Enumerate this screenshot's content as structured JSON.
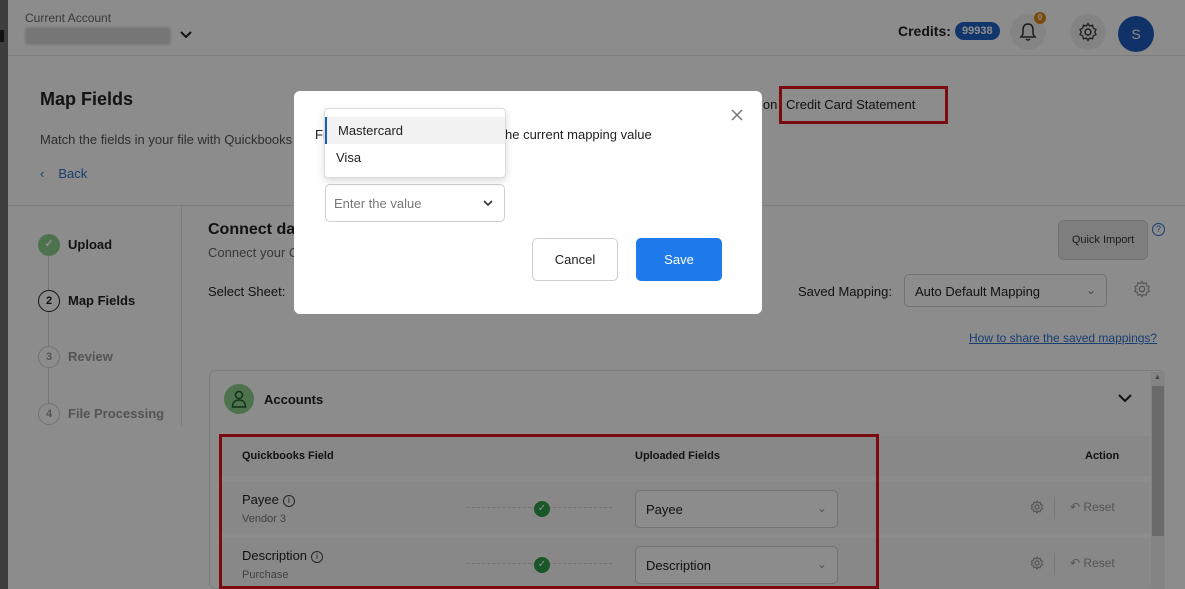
{
  "header": {
    "account_label": "Current Account",
    "credits_label": "Credits:",
    "credits_value": "99938",
    "notification_count": "0",
    "avatar_initial": "S"
  },
  "page": {
    "title": "Map Fields",
    "subtitle": "Match the fields in your file with Quickbooks f",
    "back_label": "Back",
    "statement_prefix": "ion",
    "statement_type": "Credit Card Statement"
  },
  "stepper": [
    {
      "number": "",
      "label": "Upload",
      "state": "done"
    },
    {
      "number": "2",
      "label": "Map Fields",
      "state": "active"
    },
    {
      "number": "3",
      "label": "Review",
      "state": "pending"
    },
    {
      "number": "4",
      "label": "File Processing",
      "state": "pending"
    }
  ],
  "content": {
    "connect_title": "Connect da",
    "connect_sub": "Connect your C",
    "select_sheet_label": "Select Sheet:",
    "quick_import_label": "Quick Import",
    "help_glyph": "?",
    "saved_mapping_label": "Saved Mapping:",
    "saved_mapping_value": "Auto Default Mapping",
    "share_link": "How to share the saved mappings?"
  },
  "accounts_section": {
    "title": "Accounts",
    "columns": {
      "field": "Quickbooks Field",
      "uploaded": "Uploaded Fields",
      "action": "Action"
    },
    "rows": [
      {
        "field": "Payee",
        "sub": "Vendor 3",
        "uploaded": "Payee",
        "reset": "Reset"
      },
      {
        "field": "Description",
        "sub": "Purchase",
        "uploaded": "Description",
        "reset": "Reset"
      }
    ]
  },
  "modal": {
    "text_left": "Fi",
    "text_right": "he current mapping value",
    "select_placeholder": "Enter the value",
    "options": [
      "Mastercard",
      "Visa"
    ],
    "active_option": "Mastercard",
    "cancel_label": "Cancel",
    "save_label": "Save"
  },
  "colors": {
    "primary": "#1f7aeb",
    "avatar": "#1f5bbd",
    "success": "#2e9e4a",
    "highlight": "#e0141e",
    "notification": "#e1891b"
  }
}
